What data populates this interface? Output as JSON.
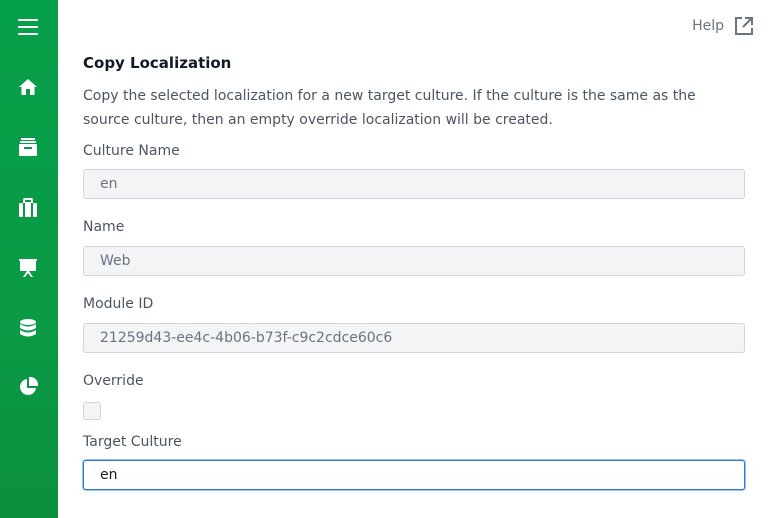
{
  "help": {
    "label": "Help"
  },
  "sidebar": {
    "items": [
      {
        "icon": "menu-icon"
      },
      {
        "icon": "home-icon"
      },
      {
        "icon": "archive-icon"
      },
      {
        "icon": "briefcase-icon"
      },
      {
        "icon": "presentation-icon"
      },
      {
        "icon": "database-icon"
      },
      {
        "icon": "pie-chart-icon"
      }
    ]
  },
  "form": {
    "title": "Copy Localization",
    "description": "Copy the selected localization for a new target culture. If the culture is the same as the source culture, then an empty override localization will be created.",
    "culture_name": {
      "label": "Culture Name",
      "value": "en"
    },
    "name": {
      "label": "Name",
      "value": "Web"
    },
    "module_id": {
      "label": "Module ID",
      "value": "21259d43-ee4c-4b06-b73f-c9c2cdce60c6"
    },
    "override": {
      "label": "Override",
      "checked": false
    },
    "target_culture": {
      "label": "Target Culture",
      "value": "en"
    }
  },
  "colors": {
    "sidebar": "#07a04a",
    "focus_border": "#2b78d6"
  }
}
